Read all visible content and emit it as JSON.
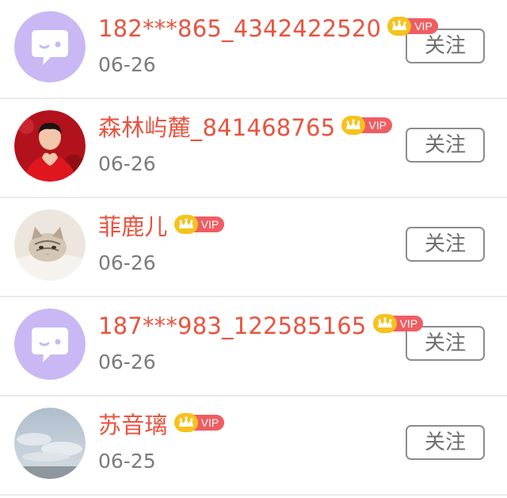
{
  "colors": {
    "username": "#e9533f",
    "date": "#7b7b7b",
    "vip_tag": "#ef5d62",
    "crown": "#f6c21c",
    "default_avatar": "#c9b8f4",
    "button_border": "#8d8d8d",
    "divider": "#ececec"
  },
  "users": [
    {
      "name": "182***865_4342422520",
      "vip": "VIP",
      "date": "06-26",
      "follow": "关注",
      "avatar": "default-chat-bubble-avatar"
    },
    {
      "name": "森林屿麓_841468765",
      "vip": "VIP",
      "date": "06-26",
      "follow": "关注",
      "avatar": "person-red-heart-hands-photo"
    },
    {
      "name": "菲鹿儿",
      "vip": "VIP",
      "date": "06-26",
      "follow": "关注",
      "avatar": "kitten-photo"
    },
    {
      "name": "187***983_122585165",
      "vip": "VIP",
      "date": "06-26",
      "follow": "关注",
      "avatar": "default-chat-bubble-avatar"
    },
    {
      "name": "苏音璃",
      "vip": "VIP",
      "date": "06-25",
      "follow": "关注",
      "avatar": "cloudy-sky-photo"
    }
  ]
}
